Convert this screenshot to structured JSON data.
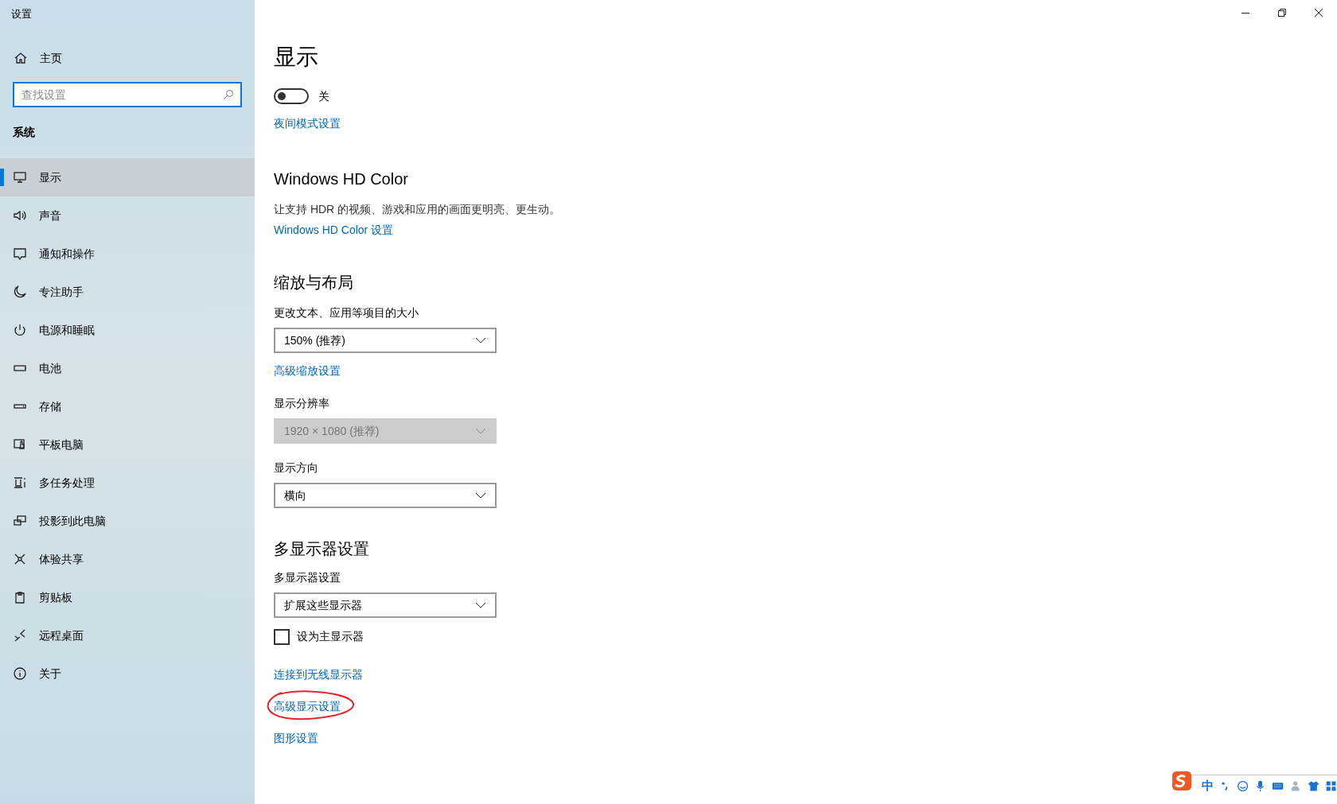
{
  "window": {
    "title": "设置"
  },
  "sidebar": {
    "home": "主页",
    "search": {
      "placeholder": "查找设置"
    },
    "section": "系统",
    "items": [
      {
        "label": "显示",
        "selected": true
      },
      {
        "label": "声音",
        "selected": false
      },
      {
        "label": "通知和操作",
        "selected": false
      },
      {
        "label": "专注助手",
        "selected": false
      },
      {
        "label": "电源和睡眠",
        "selected": false
      },
      {
        "label": "电池",
        "selected": false
      },
      {
        "label": "存储",
        "selected": false
      },
      {
        "label": "平板电脑",
        "selected": false
      },
      {
        "label": "多任务处理",
        "selected": false
      },
      {
        "label": "投影到此电脑",
        "selected": false
      },
      {
        "label": "体验共享",
        "selected": false
      },
      {
        "label": "剪贴板",
        "selected": false
      },
      {
        "label": "远程桌面",
        "selected": false
      },
      {
        "label": "关于",
        "selected": false
      }
    ]
  },
  "page": {
    "title": "显示",
    "night_light": {
      "toggle": {
        "on": false,
        "state_label": "关"
      },
      "link": "夜间模式设置"
    },
    "hdr": {
      "heading": "Windows HD Color",
      "description": "让支持 HDR 的视频、游戏和应用的画面更明亮、更生动。",
      "link": "Windows HD Color 设置"
    },
    "scale": {
      "heading": "缩放与布局",
      "fields": [
        {
          "kind": "dropdown",
          "label": "更改文本、应用等项目的大小",
          "value": "150% (推荐)",
          "disabled": false
        },
        {
          "kind": "link",
          "text": "高级缩放设置"
        },
        {
          "kind": "dropdown",
          "label": "显示分辨率",
          "value": "1920 × 1080 (推荐)",
          "disabled": true
        },
        {
          "kind": "dropdown",
          "label": "显示方向",
          "value": "横向",
          "disabled": false
        }
      ]
    },
    "multi": {
      "heading": "多显示器设置",
      "dropdown": {
        "label": "多显示器设置",
        "value": "扩展这些显示器",
        "disabled": false
      },
      "checkbox": {
        "label": "设为主显示器",
        "checked": false
      },
      "links": [
        {
          "text": "连接到无线显示器",
          "circled": false
        },
        {
          "text": "高级显示设置",
          "circled": true
        },
        {
          "text": "图形设置",
          "circled": false
        }
      ]
    }
  },
  "ime_toolbar": {
    "mode": "中"
  }
}
